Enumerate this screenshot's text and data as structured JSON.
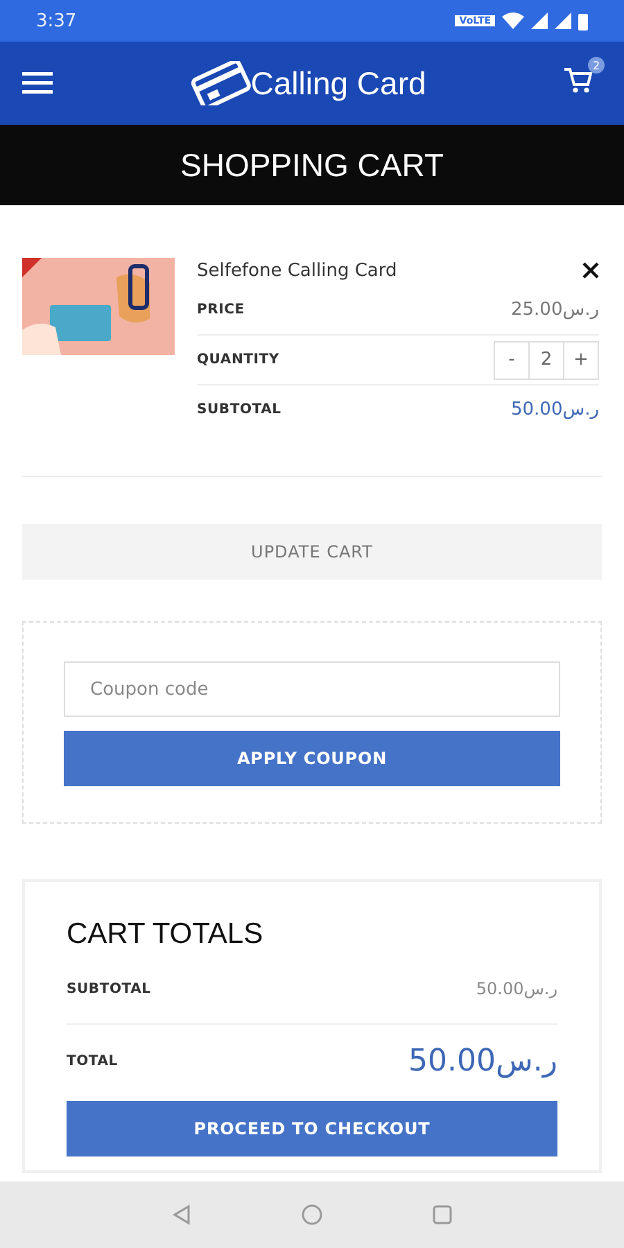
{
  "status_bar": {
    "time": "3:37",
    "network_badge": "VoLTE"
  },
  "header": {
    "logo_text": "Calling Card",
    "cart_count": "2"
  },
  "page_title": "SHOPPING CART",
  "cart_item": {
    "name": "Selfefone Calling Card",
    "rows": [
      {
        "kind": "price",
        "label": "PRICE",
        "amount": "25.00",
        "currency": "ر.س"
      },
      {
        "kind": "quantity",
        "label": "QUANTITY",
        "minus": "-",
        "value": "2",
        "plus": "+"
      },
      {
        "kind": "subtotal",
        "label": "SUBTOTAL",
        "amount": "50.00",
        "currency": "ر.س"
      }
    ]
  },
  "update_button": "UPDATE CART",
  "coupon": {
    "placeholder": "Coupon code",
    "button": "APPLY COUPON"
  },
  "totals": {
    "title": "CART TOTALS",
    "rows": [
      {
        "kind": "subtotal",
        "label": "SUBTOTAL",
        "amount": "50.00",
        "currency": "ر.س"
      },
      {
        "kind": "total",
        "label": "TOTAL",
        "amount": "50.00",
        "currency": "ر.س"
      }
    ],
    "button": "PROCEED TO CHECKOUT"
  }
}
